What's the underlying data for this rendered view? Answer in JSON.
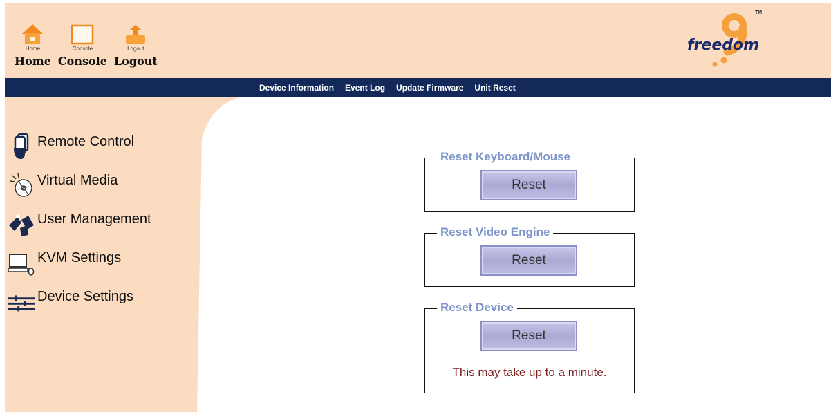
{
  "header": {
    "nav": [
      {
        "icon": "home-icon",
        "tiny_label": "Home",
        "label": "Home"
      },
      {
        "icon": "console-icon",
        "tiny_label": "Console",
        "label": "Console"
      },
      {
        "icon": "logout-icon",
        "tiny_label": "Logout",
        "label": "Logout"
      }
    ],
    "logo": {
      "text": "freedom",
      "mark": "9",
      "tm": "TM"
    }
  },
  "navbar": {
    "items": [
      "Device Information",
      "Event Log",
      "Update Firmware",
      "Unit Reset"
    ]
  },
  "sidebar": {
    "items": [
      {
        "icon": "remote-control-icon",
        "label": "Remote Control"
      },
      {
        "icon": "virtual-media-icon",
        "label": "Virtual Media"
      },
      {
        "icon": "user-management-icon",
        "label": "User Management"
      },
      {
        "icon": "kvm-settings-icon",
        "label": "KVM Settings"
      },
      {
        "icon": "device-settings-icon",
        "label": "Device Settings"
      }
    ]
  },
  "main": {
    "groups": [
      {
        "legend": "Reset Keyboard/Mouse",
        "button": "Reset"
      },
      {
        "legend": "Reset Video Engine",
        "button": "Reset"
      },
      {
        "legend": "Reset Device",
        "button": "Reset",
        "note": "This may take up to a minute."
      }
    ]
  },
  "colors": {
    "header_bg": "#fcdcc0",
    "navbar_bg": "#13295a",
    "legend": "#7d95c9",
    "note": "#7a1d1d",
    "logo_orange": "#f5a03c"
  }
}
